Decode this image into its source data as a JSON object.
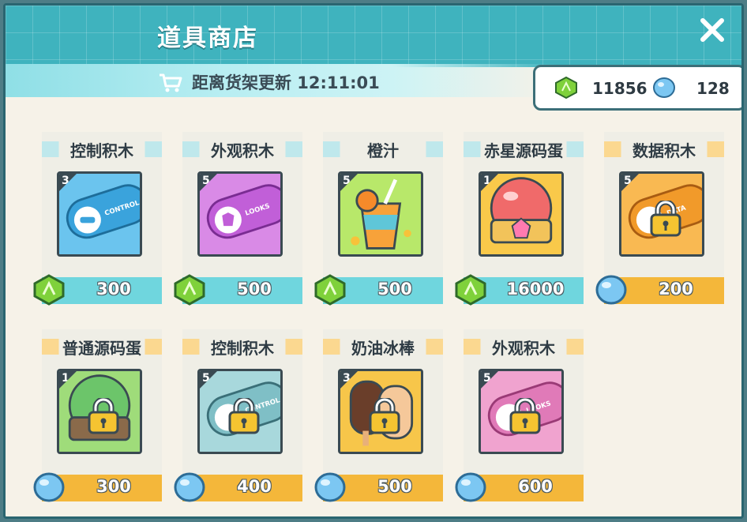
{
  "window": {
    "title": "道具商店"
  },
  "refresh": {
    "label": "距离货架更新 12:11:01"
  },
  "currency": {
    "green": "11856",
    "blue": "128"
  },
  "colors": {
    "teal": "#3fb3be",
    "cyan_bar": "#6fd6de",
    "orange_bar": "#f4b73a",
    "cyan_tag": "#bfe8ec",
    "orange_tag": "#fbd890"
  },
  "items": [
    {
      "name": "控制积木",
      "level": "3",
      "price": "300",
      "currency": "green-gem-icon",
      "locked": false,
      "art": "blue-controller"
    },
    {
      "name": "外观积木",
      "level": "5",
      "price": "500",
      "currency": "green-gem-icon",
      "locked": false,
      "art": "purple-looks"
    },
    {
      "name": "橙汁",
      "level": "5",
      "price": "500",
      "currency": "green-gem-icon",
      "locked": false,
      "art": "orange-juice"
    },
    {
      "name": "赤星源码蛋",
      "level": "1",
      "price": "16000",
      "currency": "green-gem-icon",
      "locked": false,
      "art": "red-egg"
    },
    {
      "name": "数据积木",
      "level": "5",
      "price": "200",
      "currency": "blue-orb-icon",
      "locked": true,
      "art": "orange-data"
    },
    {
      "name": "普通源码蛋",
      "level": "1",
      "price": "300",
      "currency": "blue-orb-icon",
      "locked": true,
      "art": "green-egg"
    },
    {
      "name": "控制积木",
      "level": "5",
      "price": "400",
      "currency": "blue-orb-icon",
      "locked": true,
      "art": "teal-controller"
    },
    {
      "name": "奶油冰棒",
      "level": "3",
      "price": "500",
      "currency": "blue-orb-icon",
      "locked": true,
      "art": "ice-cream"
    },
    {
      "name": "外观积木",
      "level": "5",
      "price": "600",
      "currency": "blue-orb-icon",
      "locked": true,
      "art": "pink-looks"
    }
  ]
}
